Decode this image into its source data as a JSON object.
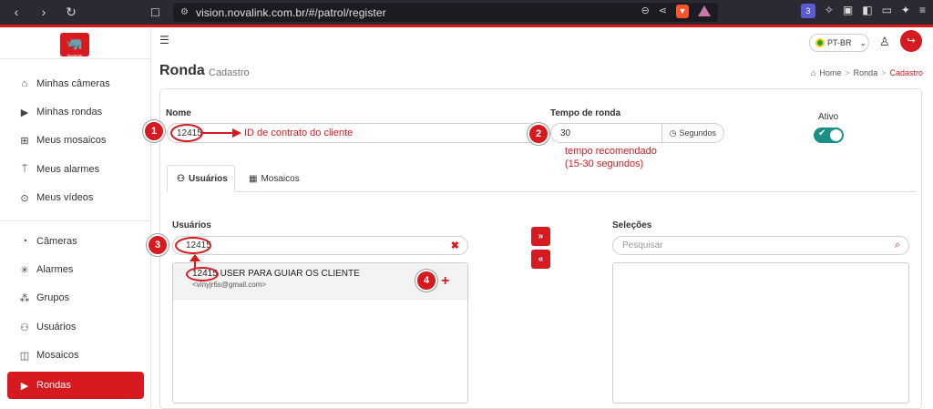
{
  "browser": {
    "url": "vision.novalink.com.br/#/patrol/register",
    "ext_badge": "3"
  },
  "logo": {
    "glyph": "🦏",
    "label": "NovaLink"
  },
  "sidebar": {
    "items": [
      {
        "label": "Minhas câmeras"
      },
      {
        "label": "Minhas rondas"
      },
      {
        "label": "Meus mosaicos"
      },
      {
        "label": "Meus alarmes"
      },
      {
        "label": "Meus vídeos"
      },
      {
        "label": "Câmeras"
      },
      {
        "label": "Alarmes"
      },
      {
        "label": "Grupos"
      },
      {
        "label": "Usuários"
      },
      {
        "label": "Mosaicos"
      },
      {
        "label": "Rondas"
      }
    ]
  },
  "header": {
    "language": "PT-BR"
  },
  "page": {
    "title": "Ronda",
    "subtitle": "Cadastro"
  },
  "breadcrumb": {
    "home": "Home",
    "section": "Ronda",
    "current": "Cadastro"
  },
  "form": {
    "name_label": "Nome",
    "name_value": "12415",
    "time_label": "Tempo de ronda",
    "time_value": "30",
    "time_unit": "Segundos",
    "active_label": "Ativo",
    "active": true
  },
  "tabs": [
    {
      "label": "Usuários"
    },
    {
      "label": "Mosaicos"
    }
  ],
  "users": {
    "label": "Usuários",
    "search_value": "12415",
    "results": [
      {
        "name": "12415  USER PARA GUIAR OS CLIENTE",
        "email": "<vinyjr6s@gmail.com>"
      }
    ]
  },
  "selections": {
    "label": "Seleções",
    "placeholder": "Pesquisar"
  },
  "move": {
    "add_all": "»",
    "remove_all": "«"
  },
  "annotations": {
    "badges": [
      "1",
      "2",
      "3",
      "4"
    ],
    "name_note": "ID de contrato do cliente",
    "time_note_line1": "tempo recomendado",
    "time_note_line2": "(15-30 segundos)"
  }
}
